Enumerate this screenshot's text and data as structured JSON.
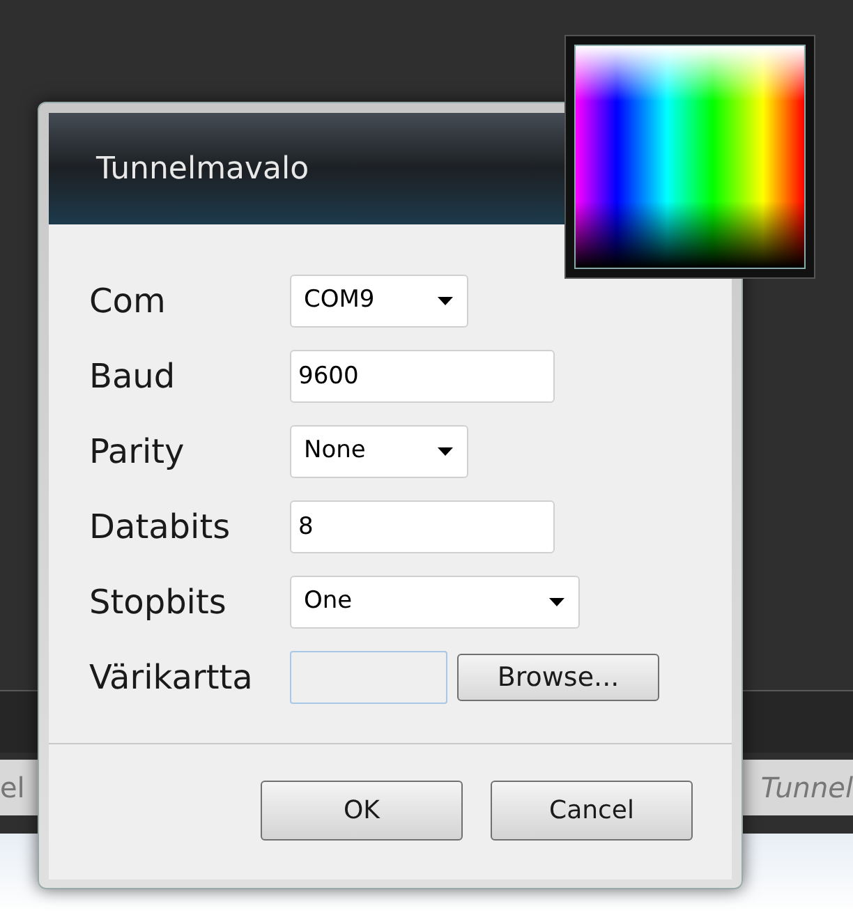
{
  "background_texts": [
    {
      "text": "el",
      "italic": false
    },
    {
      "text": "Tunnel",
      "italic": true
    }
  ],
  "dialog": {
    "title": "Tunnelmavalo",
    "fields": [
      {
        "label": "Com",
        "kind": "dropdown",
        "value": "COM9"
      },
      {
        "label": "Baud",
        "kind": "text",
        "value": "9600"
      },
      {
        "label": "Parity",
        "kind": "dropdown",
        "value": "None"
      },
      {
        "label": "Databits",
        "kind": "text",
        "value": "8"
      },
      {
        "label": "Stopbits",
        "kind": "dropdown",
        "value": "One"
      },
      {
        "label": "Värikartta",
        "kind": "file",
        "button": "Browse..."
      }
    ],
    "buttons": [
      "OK",
      "Cancel"
    ]
  }
}
